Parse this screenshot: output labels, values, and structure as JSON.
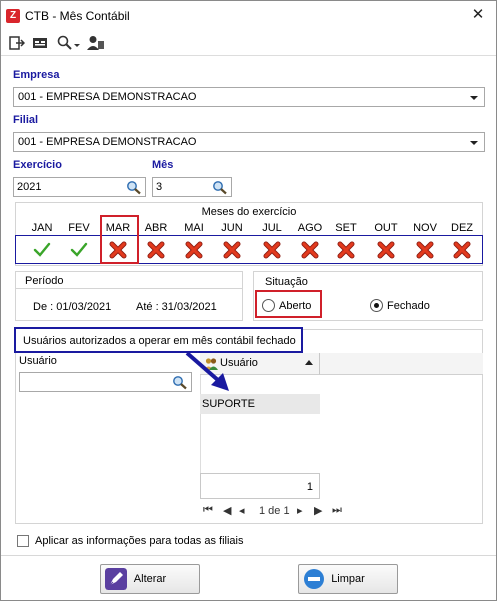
{
  "window": {
    "title": "CTB - Mês Contábil"
  },
  "form": {
    "empresa_label": "Empresa",
    "empresa_value": "001 - EMPRESA DEMONSTRACAO",
    "filial_label": "Filial",
    "filial_value": "001 - EMPRESA DEMONSTRACAO",
    "exercicio_label": "Exercício",
    "exercicio_value": "2021",
    "mes_label": "Mês",
    "mes_value": "3"
  },
  "months": {
    "title": "Meses do exercício",
    "items": [
      {
        "label": "JAN",
        "status": "open"
      },
      {
        "label": "FEV",
        "status": "open"
      },
      {
        "label": "MAR",
        "status": "closed"
      },
      {
        "label": "ABR",
        "status": "closed"
      },
      {
        "label": "MAI",
        "status": "closed"
      },
      {
        "label": "JUN",
        "status": "closed"
      },
      {
        "label": "JUL",
        "status": "closed"
      },
      {
        "label": "AGO",
        "status": "closed"
      },
      {
        "label": "SET",
        "status": "closed"
      },
      {
        "label": "OUT",
        "status": "closed"
      },
      {
        "label": "NOV",
        "status": "closed"
      },
      {
        "label": "DEZ",
        "status": "closed"
      }
    ]
  },
  "periodo": {
    "title": "Período",
    "de": "De : 01/03/2021",
    "ate": "Até : 31/03/2021"
  },
  "situacao": {
    "title": "Situação",
    "aberto": "Aberto",
    "fechado": "Fechado",
    "selected": "Fechado"
  },
  "usuarios": {
    "title": "Usuários autorizados a operar em mês contábil fechado",
    "search_label": "Usuário",
    "search_value": "",
    "grid_header": "Usuário",
    "rows": [
      "SUPORTE"
    ],
    "count": "1",
    "page_info": "1 de 1"
  },
  "aplicar_label": "Aplicar as informações para todas as filiais",
  "buttons": {
    "alterar": "Alterar",
    "limpar": "Limpar"
  },
  "colors": {
    "accent_blue": "#1a1aa0",
    "highlight_red": "#d0202a",
    "open_green": "#3aa52a",
    "closed_red": "#e23a1e"
  }
}
